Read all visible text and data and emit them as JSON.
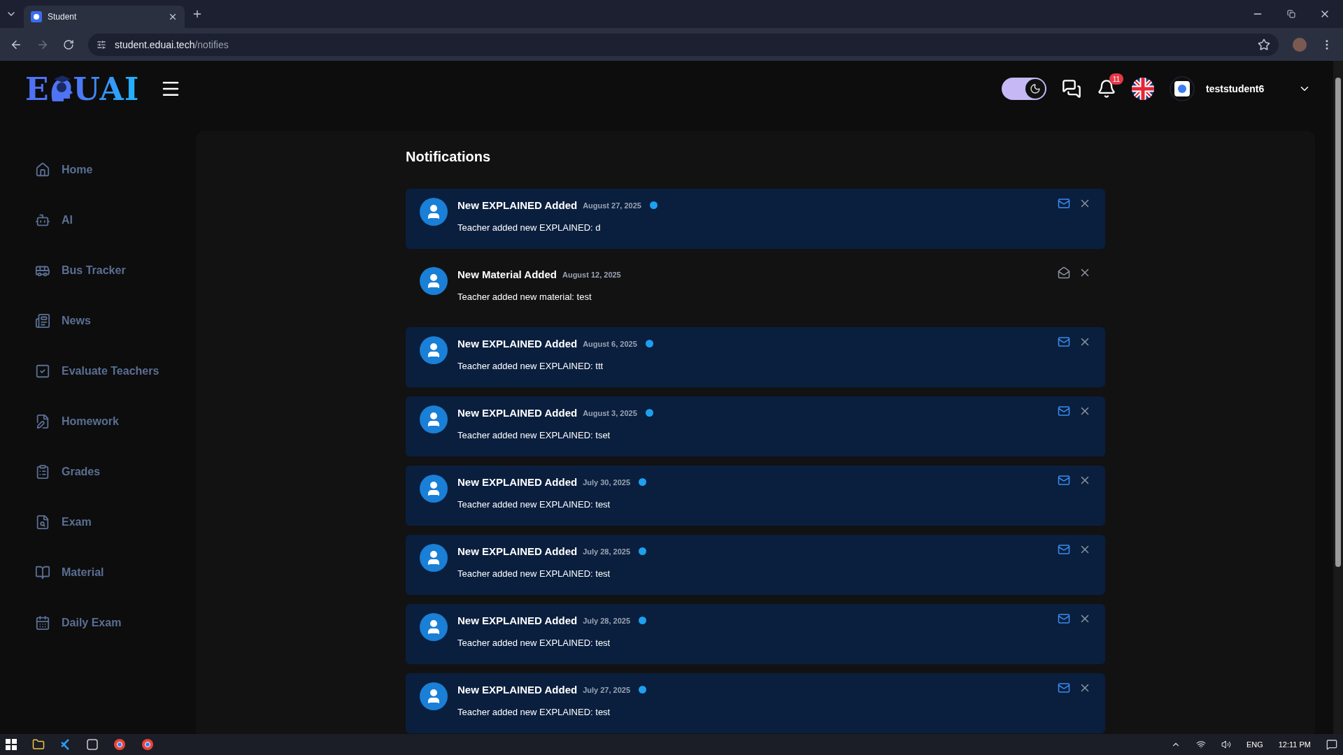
{
  "browser": {
    "tab_title": "Student",
    "url_host": "student.eduai.tech",
    "url_path": "/notifies"
  },
  "header": {
    "logo_left": "E",
    "logo_right": "UAI",
    "dark_mode": true,
    "notification_count": "11",
    "username": "teststudent6"
  },
  "sidebar": {
    "items": [
      {
        "label": "Home"
      },
      {
        "label": "AI"
      },
      {
        "label": "Bus Tracker"
      },
      {
        "label": "News"
      },
      {
        "label": "Evaluate Teachers"
      },
      {
        "label": "Homework"
      },
      {
        "label": "Grades"
      },
      {
        "label": "Exam"
      },
      {
        "label": "Material"
      },
      {
        "label": "Daily Exam"
      }
    ]
  },
  "page_title": "Notifications",
  "notifications": [
    {
      "title": "New EXPLAINED Added",
      "date": "August 27, 2025",
      "body": "Teacher added new EXPLAINED: d",
      "unread": true
    },
    {
      "title": "New Material Added",
      "date": "August 12, 2025",
      "body": "Teacher added new material: test",
      "unread": false
    },
    {
      "title": "New EXPLAINED Added",
      "date": "August 6, 2025",
      "body": "Teacher added new EXPLAINED: ttt",
      "unread": true
    },
    {
      "title": "New EXPLAINED Added",
      "date": "August 3, 2025",
      "body": "Teacher added new EXPLAINED: tset",
      "unread": true
    },
    {
      "title": "New EXPLAINED Added",
      "date": "July 30, 2025",
      "body": "Teacher added new EXPLAINED: test",
      "unread": true
    },
    {
      "title": "New EXPLAINED Added",
      "date": "July 28, 2025",
      "body": "Teacher added new EXPLAINED: test",
      "unread": true
    },
    {
      "title": "New EXPLAINED Added",
      "date": "July 28, 2025",
      "body": "Teacher added new EXPLAINED: test",
      "unread": true
    },
    {
      "title": "New EXPLAINED Added",
      "date": "July 27, 2025",
      "body": "Teacher added new EXPLAINED: test",
      "unread": true
    }
  ],
  "taskbar": {
    "language": "ENG",
    "time": "12:11 PM"
  }
}
